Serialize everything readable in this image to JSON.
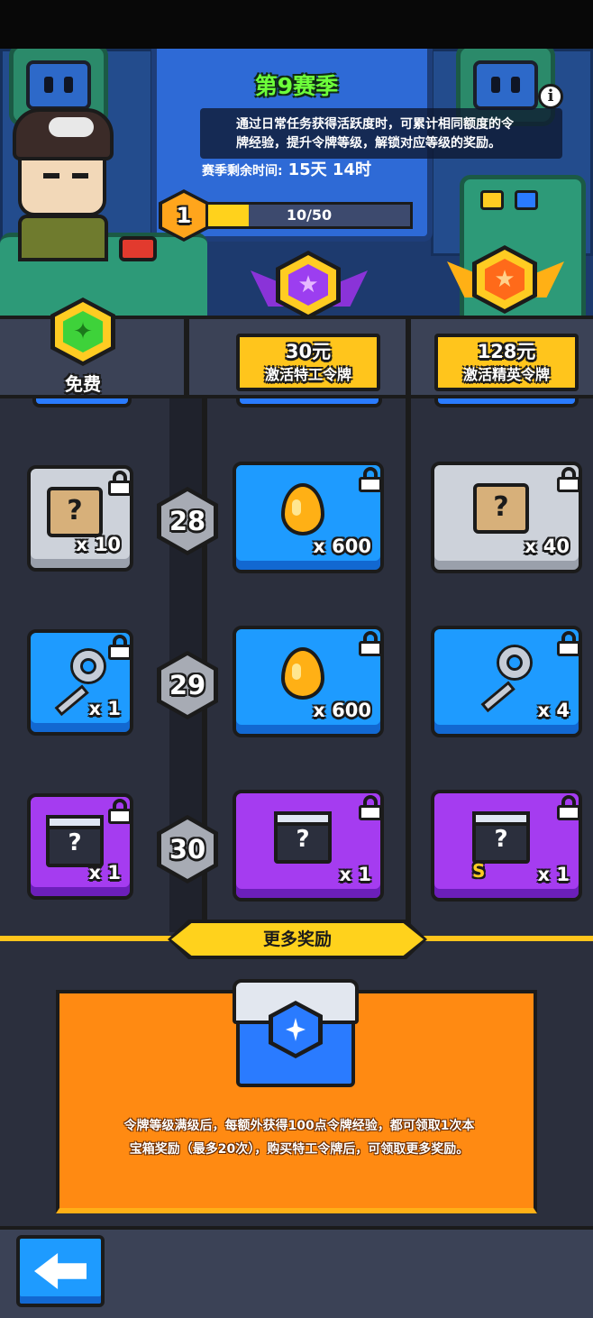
{
  "season": {
    "title": "第9赛季",
    "description_line1": "通过日常任务获得活跃度时，可累计相同额度的令",
    "description_line2": "牌经验，提升令牌等级，解锁对应等级的奖励。",
    "remaining_label": "赛季剩余时间:",
    "remaining_value": "15天 14时",
    "info_icon": "info-icon"
  },
  "progress": {
    "level": "1",
    "xp_text": "10/50",
    "xp_fraction": 0.2
  },
  "columns": {
    "free": {
      "label": "免费"
    },
    "agent": {
      "price": "30元",
      "name": "激活特工令牌"
    },
    "elite": {
      "price": "128元",
      "name": "激活精英令牌"
    }
  },
  "rows": [
    {
      "level": "28",
      "free": {
        "icon": "scroll-icon",
        "qty": "x 10",
        "color": "gray",
        "locked": true
      },
      "agent": {
        "icon": "drop-icon",
        "qty": "x 600",
        "color": "blue",
        "locked": true
      },
      "elite": {
        "icon": "scroll-icon",
        "qty": "x 40",
        "color": "gray",
        "locked": true
      }
    },
    {
      "level": "29",
      "free": {
        "icon": "key-icon",
        "qty": "x 1",
        "color": "blue",
        "locked": true
      },
      "agent": {
        "icon": "drop-icon",
        "qty": "x 600",
        "color": "blue",
        "locked": true
      },
      "elite": {
        "icon": "key-icon",
        "qty": "x 4",
        "color": "blue",
        "locked": true
      }
    },
    {
      "level": "30",
      "free": {
        "icon": "chest-icon",
        "qty": "x 1",
        "color": "purple",
        "locked": true
      },
      "agent": {
        "icon": "chest-icon",
        "qty": "x 1",
        "color": "purple",
        "locked": true
      },
      "elite": {
        "icon": "chest-icon",
        "qty": "x 1",
        "color": "purple",
        "locked": true,
        "badge": "S"
      }
    }
  ],
  "more_rewards": {
    "banner": "更多奖励",
    "line1": "令牌等级满级后，每额外获得100点令牌经验，都可领取1次本",
    "line2": "宝箱奖励（最多20次），购买特工令牌后，可领取更多奖励。"
  },
  "colors": {
    "gold": "#ffc51c",
    "tile_blue": "#1e9bff",
    "tile_purple": "#a53cf0",
    "tile_gray": "#cdd2da",
    "panel_orange": "#ff8a12"
  },
  "nav": {
    "back_icon": "back-arrow-icon"
  }
}
